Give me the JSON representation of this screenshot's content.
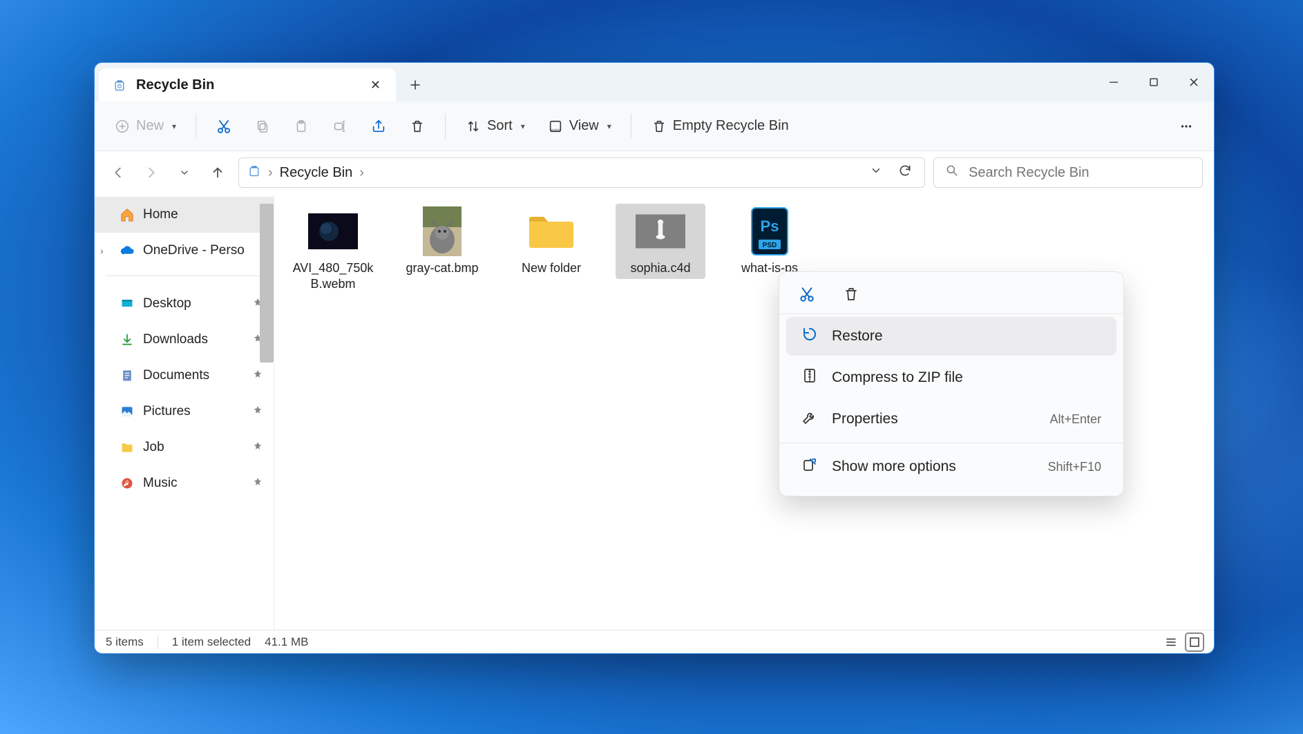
{
  "window": {
    "tab_title": "Recycle Bin"
  },
  "toolbar": {
    "new_label": "New",
    "sort_label": "Sort",
    "view_label": "View",
    "empty_label": "Empty Recycle Bin"
  },
  "breadcrumb": {
    "path": "Recycle Bin"
  },
  "search": {
    "placeholder": "Search Recycle Bin"
  },
  "sidebar": {
    "home": "Home",
    "onedrive": "OneDrive - Perso",
    "desktop": "Desktop",
    "downloads": "Downloads",
    "documents": "Documents",
    "pictures": "Pictures",
    "job": "Job",
    "music": "Music"
  },
  "files": [
    {
      "name": "AVI_480_750kB.webm"
    },
    {
      "name": "gray-cat.bmp"
    },
    {
      "name": "New folder"
    },
    {
      "name": "sophia.c4d"
    },
    {
      "name": "what-is-ps"
    }
  ],
  "context_menu": {
    "restore": "Restore",
    "compress": "Compress to ZIP file",
    "properties": "Properties",
    "properties_shortcut": "Alt+Enter",
    "show_more": "Show more options",
    "show_more_shortcut": "Shift+F10"
  },
  "statusbar": {
    "count": "5 items",
    "selected": "1 item selected",
    "size": "41.1 MB"
  }
}
